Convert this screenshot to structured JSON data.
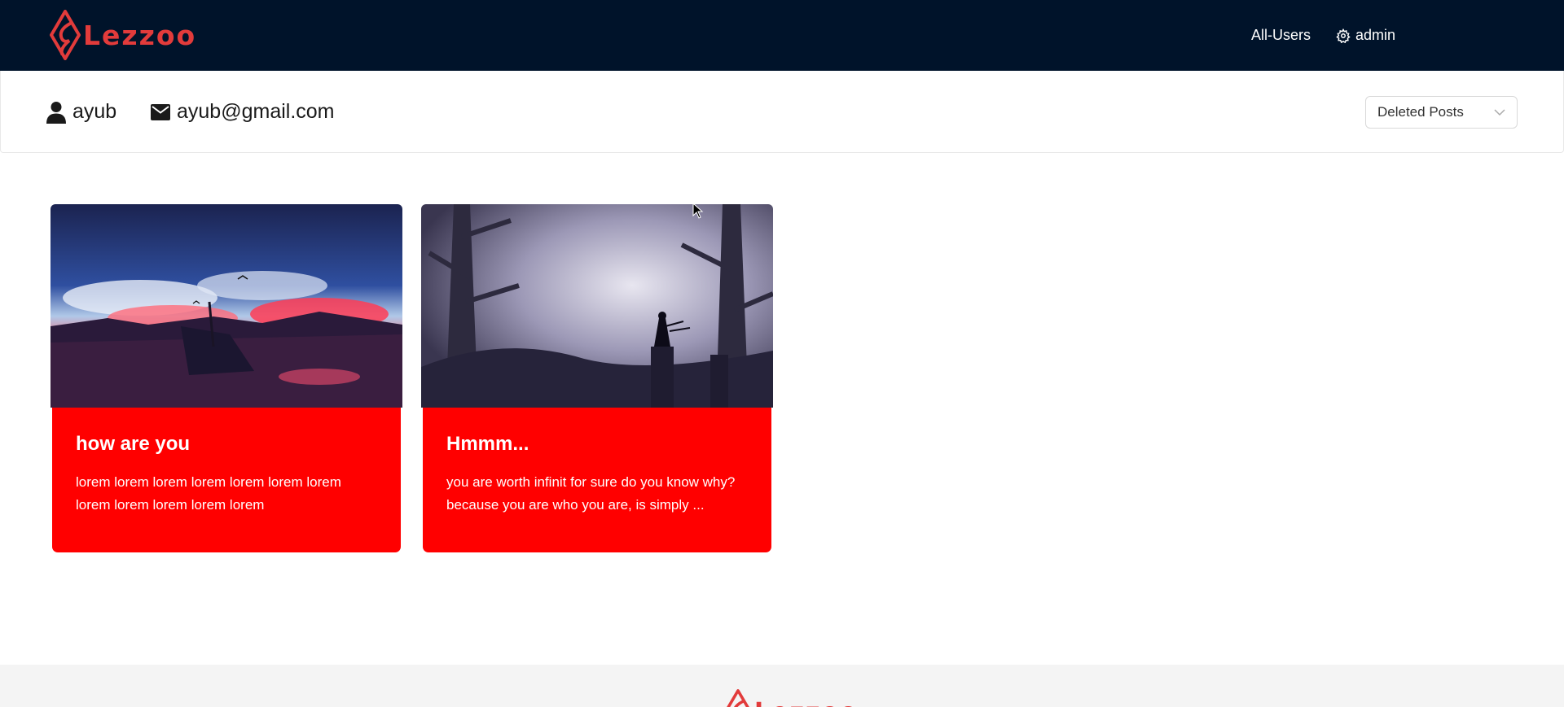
{
  "header": {
    "brand": "Lezzoo",
    "nav": {
      "all_users": "All-Users",
      "admin": "admin"
    }
  },
  "profile": {
    "username": "ayub",
    "email": "ayub@gmail.com",
    "filter": {
      "selected": "Deleted Posts"
    }
  },
  "posts": [
    {
      "title": "how are you",
      "body": "lorem lorem lorem lorem lorem lorem lorem lorem lorem lorem lorem lorem",
      "image": "sunset-shipwreck-painting"
    },
    {
      "title": "Hmmm...",
      "body": "you are worth infinit for sure do you know why? because you are who you are, is simply ...",
      "image": "misty-forest-painting"
    }
  ],
  "footer": {
    "brand": "Lezzoo"
  },
  "colors": {
    "navbar": "#00132a",
    "brand": "#e23b3b",
    "card": "#ff0000",
    "footer": "#f4f4f4"
  }
}
